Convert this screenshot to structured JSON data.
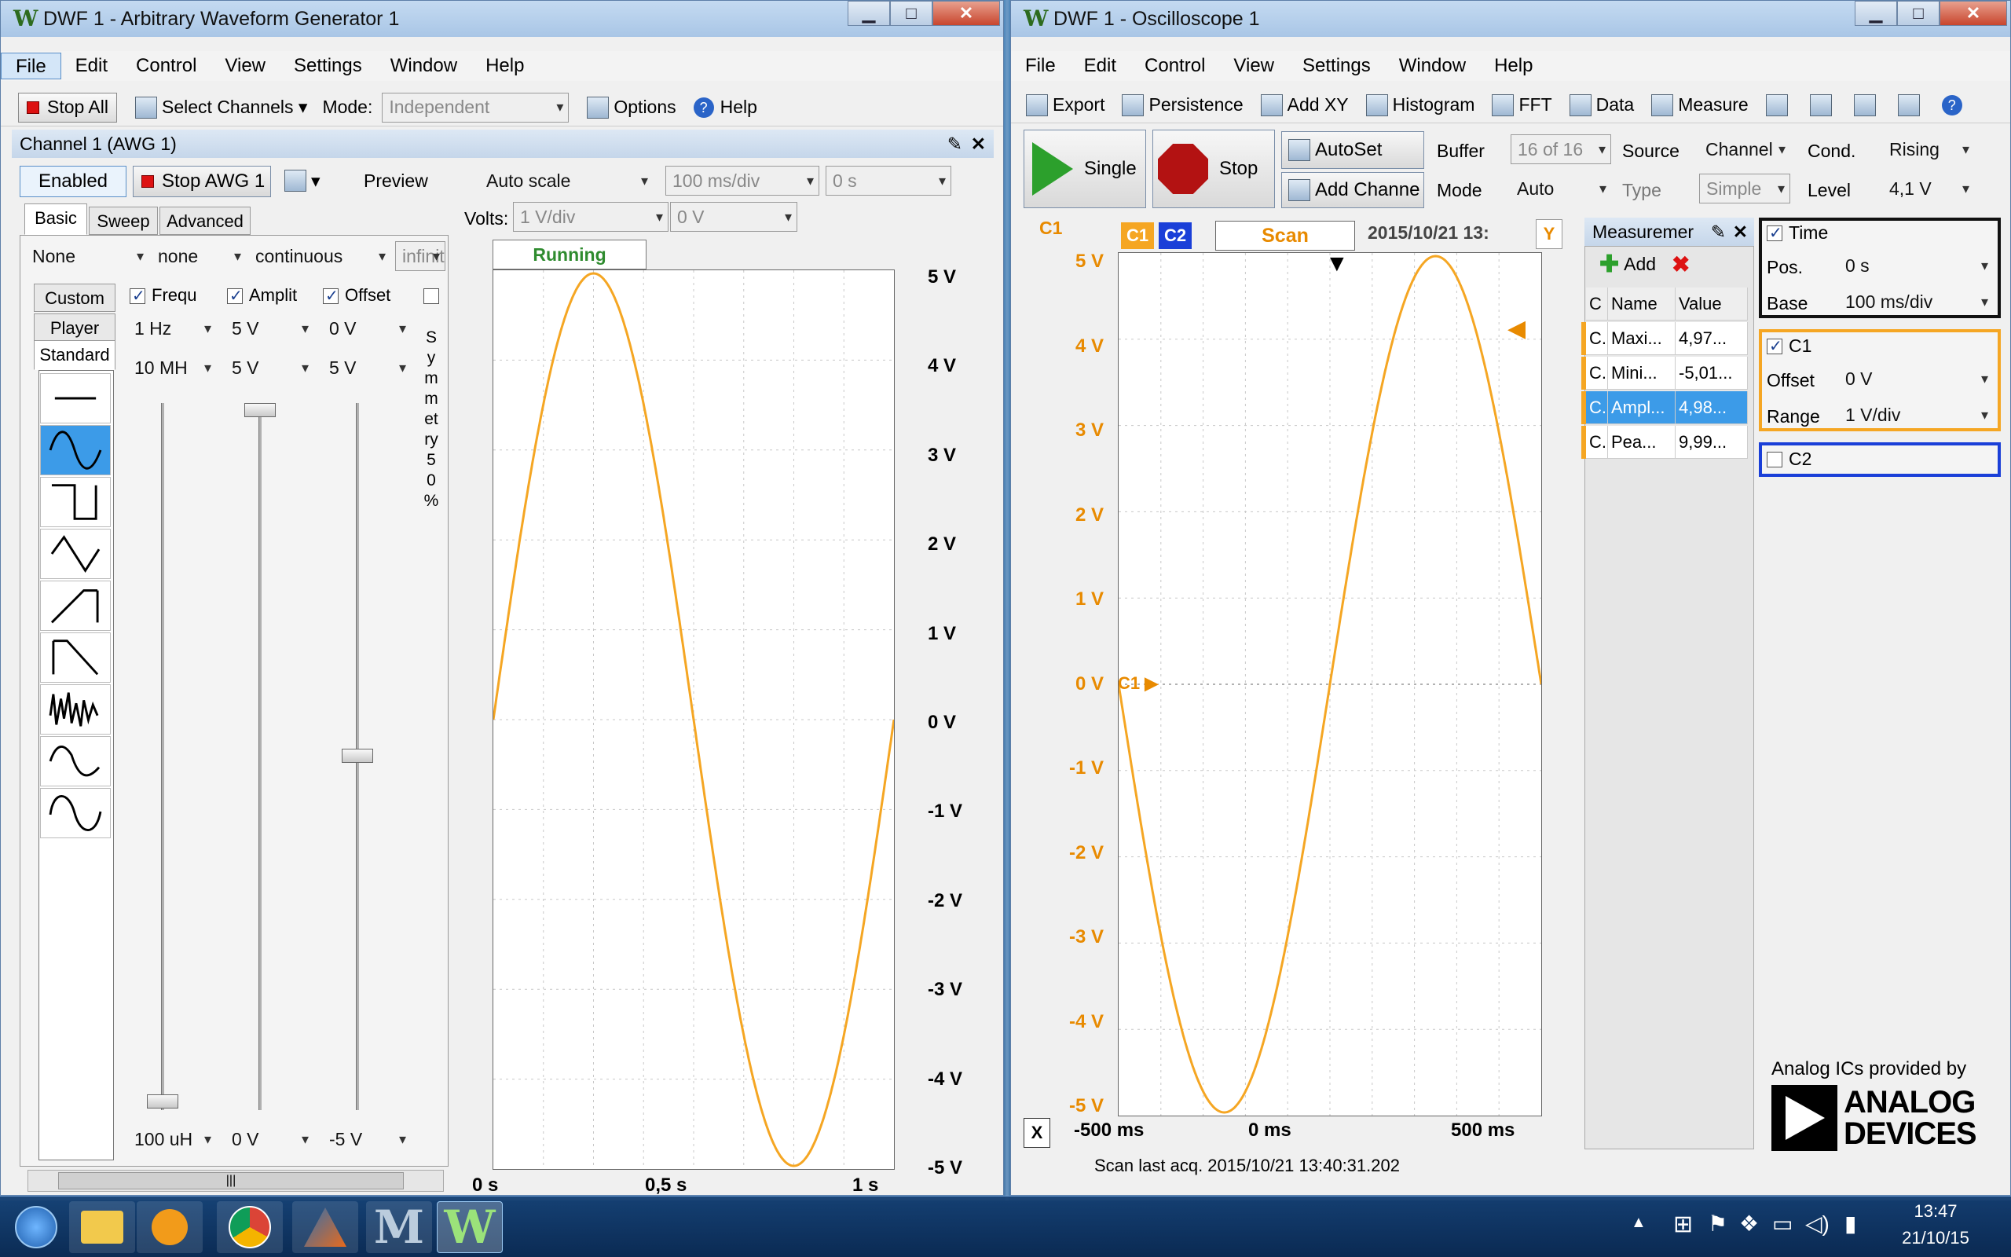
{
  "awg": {
    "title": "DWF 1 - Arbitrary Waveform Generator 1",
    "menu": [
      "File",
      "Edit",
      "Control",
      "View",
      "Settings",
      "Window",
      "Help"
    ],
    "toolbar": {
      "stop_all": "Stop All",
      "select_channels": "Select Channels",
      "mode_label": "Mode:",
      "mode_value": "Independent",
      "options": "Options",
      "help": "Help"
    },
    "channel_header": "Channel 1 (AWG 1)",
    "enabled": "Enabled",
    "stop_awg": "Stop AWG 1",
    "preview": "Preview",
    "tabs": [
      "Basic",
      "Sweep",
      "Advanced"
    ],
    "row1": {
      "a": "None",
      "b": "none",
      "c": "continuous",
      "d": "infinite"
    },
    "side_tabs": [
      "Custom",
      "Player",
      "Standard"
    ],
    "params": {
      "freq_label": "Frequ",
      "amp_label": "Amplit",
      "offset_label": "Offset",
      "freq": "1 Hz",
      "freq_max": "10 MH",
      "freq_min": "100 uH",
      "amp": "5 V",
      "amp_max": "5 V",
      "amp_min": "0 V",
      "offset": "0 V",
      "offset_max": "5 V",
      "offset_min": "-5 V"
    },
    "symmetry_label": "Symmetry 50%",
    "preview_scale": "Auto scale",
    "preview_time": "100 ms/div",
    "preview_pos": "0 s",
    "volts_label": "Volts:",
    "volts_value": "1 V/div",
    "volts_offset": "0 V",
    "status": "Running",
    "y_ticks": [
      "5 V",
      "4 V",
      "3 V",
      "2 V",
      "1 V",
      "0 V",
      "-1 V",
      "-2 V",
      "-3 V",
      "-4 V",
      "-5 V"
    ],
    "x_ticks": [
      "0 s",
      "0,5 s",
      "1 s"
    ]
  },
  "scope": {
    "title": "DWF 1 - Oscilloscope 1",
    "menu": [
      "File",
      "Edit",
      "Control",
      "View",
      "Settings",
      "Window",
      "Help"
    ],
    "toolbar": [
      "Export",
      "Persistence",
      "Add XY",
      "Histogram",
      "FFT",
      "Data",
      "Measure"
    ],
    "single": "Single",
    "stop": "Stop",
    "autoset": "AutoSet",
    "add_channel": "Add Channe",
    "buffer_label": "Buffer",
    "buffer_value": "16 of 16",
    "mode_label": "Mode",
    "mode_value": "Auto",
    "source_label": "Source",
    "source_value": "Channel",
    "type_label": "Type",
    "type_value": "Simple",
    "cond_label": "Cond.",
    "cond_value": "Rising",
    "level_label": "Level",
    "level_value": "4,1 V",
    "c1_label": "C1",
    "c2_label": "C2",
    "scan": "Scan",
    "timestamp": "2015/10/21 13:",
    "y_badge": "Y",
    "x_badge": "X",
    "y_ticks": [
      "5 V",
      "4 V",
      "3 V",
      "2 V",
      "1 V",
      "0 V",
      "-1 V",
      "-2 V",
      "-3 V",
      "-4 V",
      "-5 V"
    ],
    "x_ticks": [
      "-500 ms",
      "0 ms",
      "500 ms"
    ],
    "c1_marker": "C1",
    "measure": {
      "header": "Measuremer",
      "add": "Add",
      "cols": [
        "C",
        "Name",
        "Value"
      ],
      "rows": [
        {
          "c": "C.",
          "name": "Maxi...",
          "value": "4,97..."
        },
        {
          "c": "C.",
          "name": "Mini...",
          "value": "-5,01..."
        },
        {
          "c": "C.",
          "name": "Ampl...",
          "value": "4,98..."
        },
        {
          "c": "C.",
          "name": "Pea...",
          "value": "9,99..."
        }
      ]
    },
    "time": {
      "label": "Time",
      "pos_label": "Pos.",
      "pos_value": "0 s",
      "base_label": "Base",
      "base_value": "100 ms/div"
    },
    "c1": {
      "label": "C1",
      "offset_label": "Offset",
      "offset_value": "0 V",
      "range_label": "Range",
      "range_value": "1 V/div"
    },
    "c2": {
      "label": "C2"
    },
    "analog_caption": "Analog ICs provided by",
    "analog_logo": "ANALOG\nDEVICES",
    "status": "Scan last acq. 2015/10/21  13:40:31.202"
  },
  "taskbar": {
    "time": "13:47",
    "date": "21/10/15"
  },
  "colors": {
    "trace": "#f5a623",
    "c2": "#1a3fd8",
    "accent": "#3c9be8"
  }
}
